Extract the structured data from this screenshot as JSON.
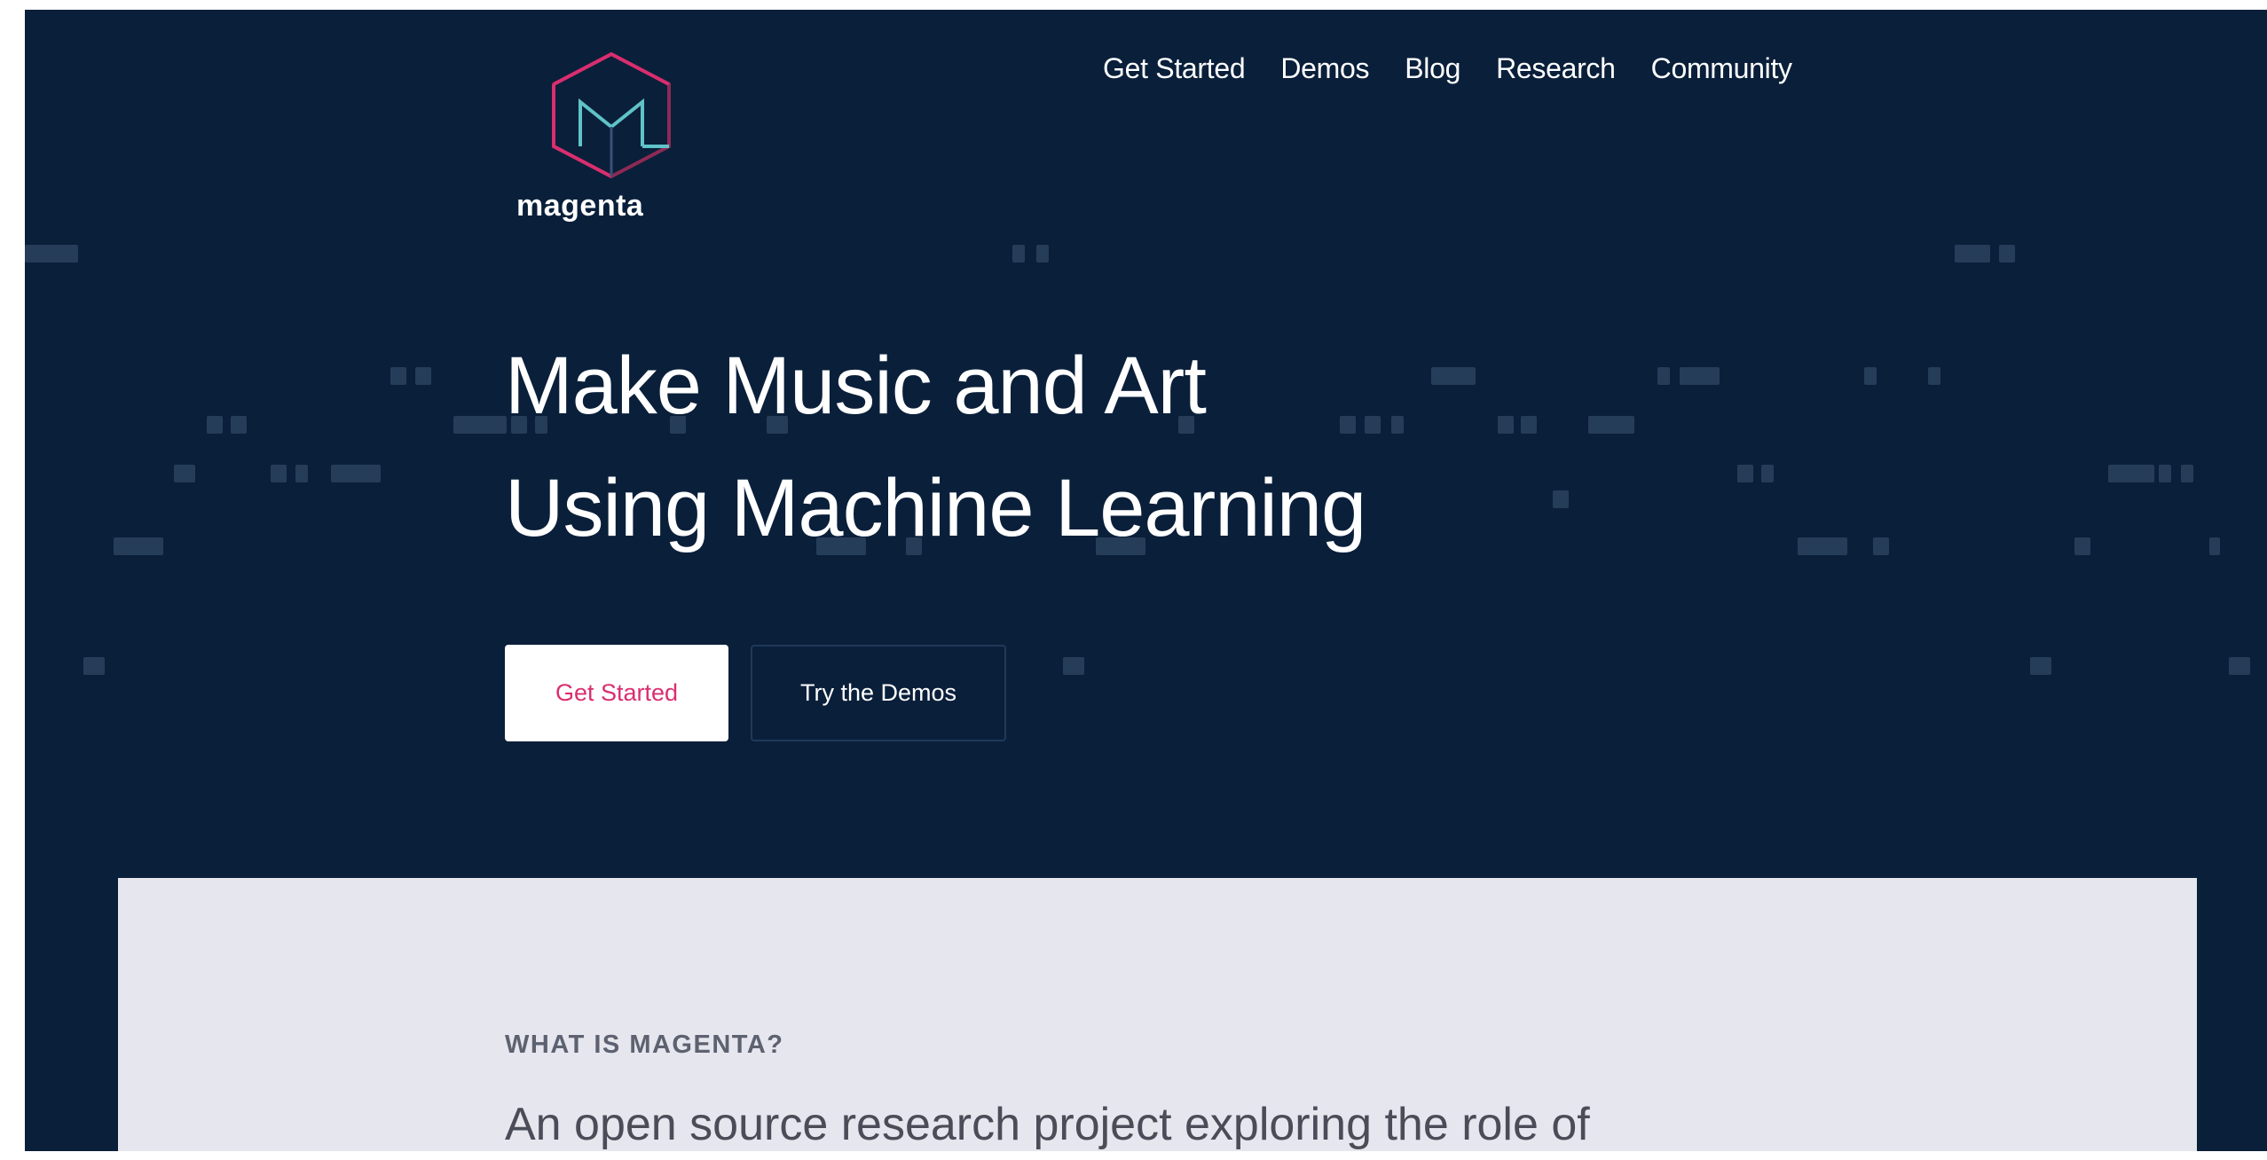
{
  "brand": {
    "name": "magenta",
    "colors": {
      "page_background": "#0a1f3a",
      "accent": "#d92e6f",
      "logo_teal": "#5fc3c8",
      "card_background": "#e6e6ee"
    }
  },
  "nav": {
    "items": [
      {
        "label": "Get Started"
      },
      {
        "label": "Demos"
      },
      {
        "label": "Blog"
      },
      {
        "label": "Research"
      },
      {
        "label": "Community"
      }
    ]
  },
  "hero": {
    "headline_line1": "Make Music and Art",
    "headline_line2": "Using Machine Learning",
    "primary_button": "Get Started",
    "secondary_button": "Try the Demos"
  },
  "about": {
    "eyebrow": "WHAT IS MAGENTA?",
    "intro": "An open source research project exploring the role of"
  },
  "icons": {
    "logo": "magenta-hexagon-logo-icon"
  }
}
